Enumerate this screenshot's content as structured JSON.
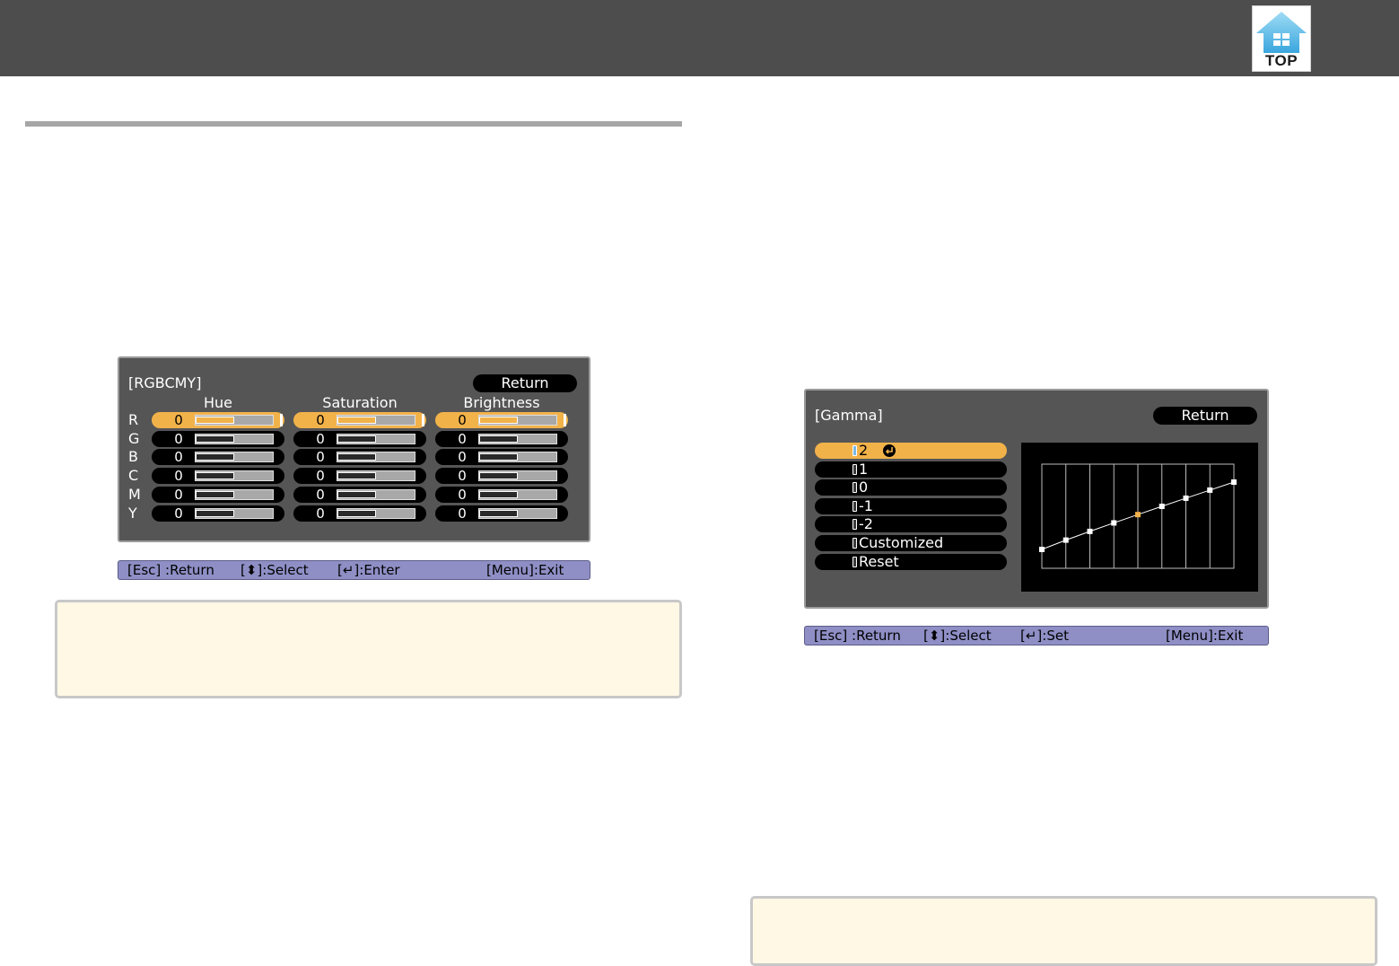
{
  "header": {
    "top_button_label": "TOP",
    "bar_color": "#4d4d4d",
    "icon": "home-icon"
  },
  "rgbcmy": {
    "title": "[RGBCMY]",
    "return_label": "Return",
    "columns": [
      "Hue",
      "Saturation",
      "Brightness"
    ],
    "rows": [
      {
        "label": "R",
        "values": [
          "0",
          "0",
          "0"
        ]
      },
      {
        "label": "G",
        "values": [
          "0",
          "0",
          "0"
        ]
      },
      {
        "label": "B",
        "values": [
          "0",
          "0",
          "0"
        ]
      },
      {
        "label": "C",
        "values": [
          "0",
          "0",
          "0"
        ]
      },
      {
        "label": "M",
        "values": [
          "0",
          "0",
          "0"
        ]
      },
      {
        "label": "Y",
        "values": [
          "0",
          "0",
          "0"
        ]
      }
    ],
    "selected_row": "R",
    "slider_level": 0.5,
    "guide": {
      "esc": "[Esc] :Return",
      "select": "[⬍]:Select",
      "enter": "[↵]:Enter",
      "menu": "[Menu]:Exit"
    }
  },
  "gamma": {
    "title": "[Gamma]",
    "return_label": "Return",
    "options": [
      "2",
      "1",
      "0",
      "-1",
      "-2",
      "Customized",
      "Reset"
    ],
    "selected": "2",
    "guide": {
      "esc": "[Esc] :Return",
      "select": "[⬍]:Select",
      "set": "[↵]:Set",
      "menu": "[Menu]:Exit"
    },
    "curve_points": 9,
    "highlight_point_index": 4
  },
  "colors": {
    "selection": "#f2b24a",
    "guide_bar": "#8f8fc6",
    "note_bg": "#fff8e5",
    "osd_bg": "#555555"
  }
}
